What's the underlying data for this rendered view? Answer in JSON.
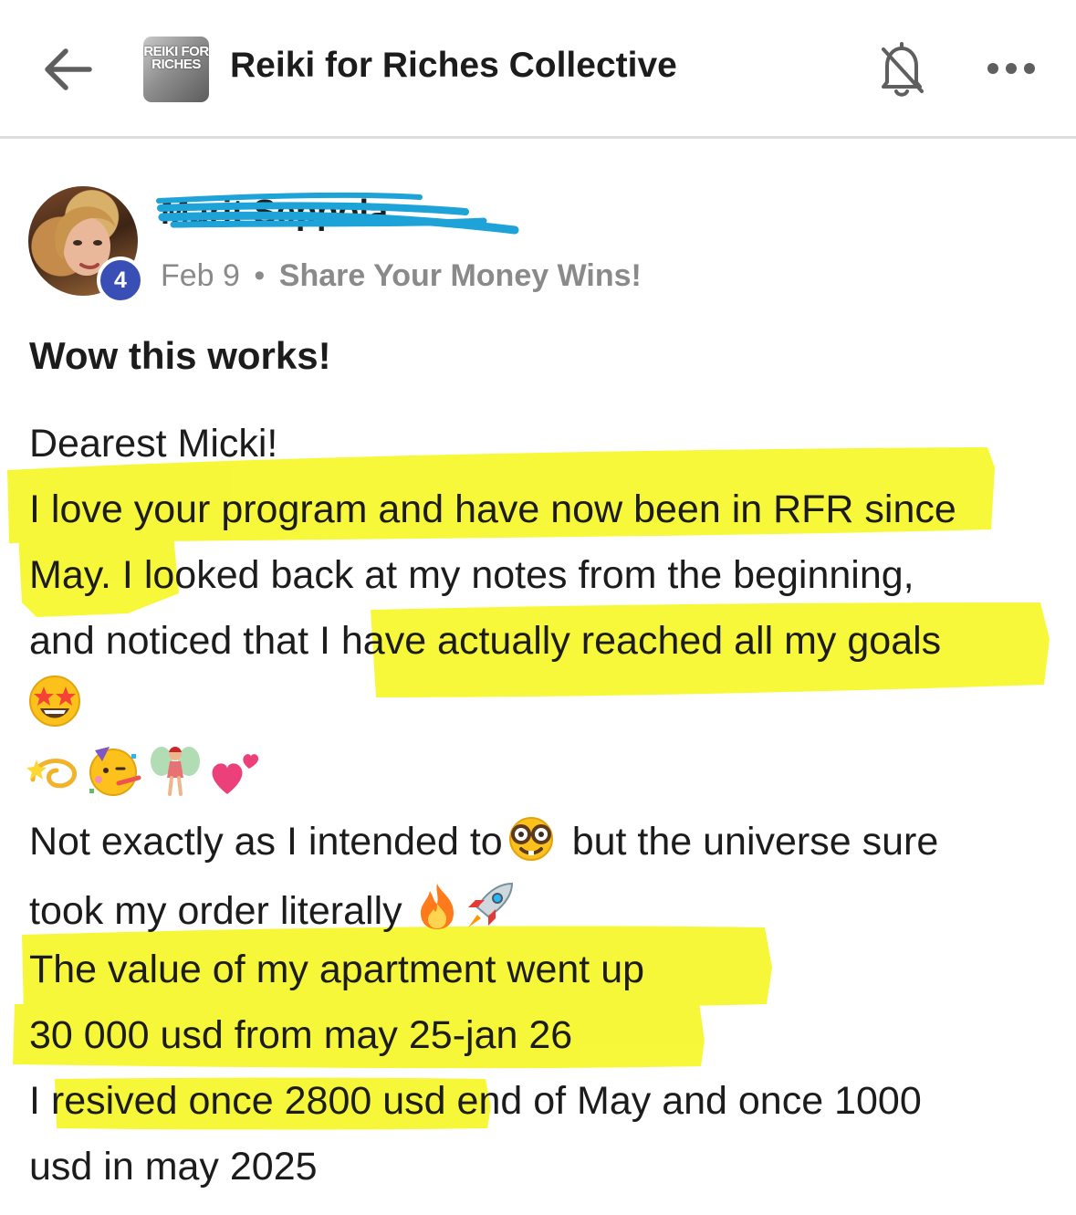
{
  "header": {
    "group_logo_text": "REIKI FOR RICHES",
    "group_title": "Reiki for Riches Collective"
  },
  "post": {
    "author_name": "Marit Seppola",
    "level": "4",
    "date": "Feb 9",
    "separator": "•",
    "category": "Share Your Money Wins!",
    "title": "Wow this works!",
    "lines": [
      "Dearest Micki!",
      "I love your program and have now been in RFR since",
      "May. I looked back at my notes from the beginning,",
      "and noticed that I have actually reached all my goals",
      "Not exactly as I intended to",
      "but the universe sure",
      "took my order literally",
      "The value of my apartment went up",
      "30 000 usd from may 25-jan 26",
      "I resived once 2800 usd end of May and once 1000",
      "usd in may 2025"
    ],
    "emojis": [
      "star-struck-emoji",
      "dizzy-emoji",
      "partying-face-emoji",
      "fairy-emoji",
      "two-hearts-emoji",
      "nerd-face-emoji",
      "fire-emoji",
      "rocket-emoji"
    ]
  },
  "colors": {
    "highlight": "#f7f72a",
    "badge": "#3a4fb5",
    "redaction": "#1ea3d8",
    "meta_text": "#8a8a8a"
  }
}
